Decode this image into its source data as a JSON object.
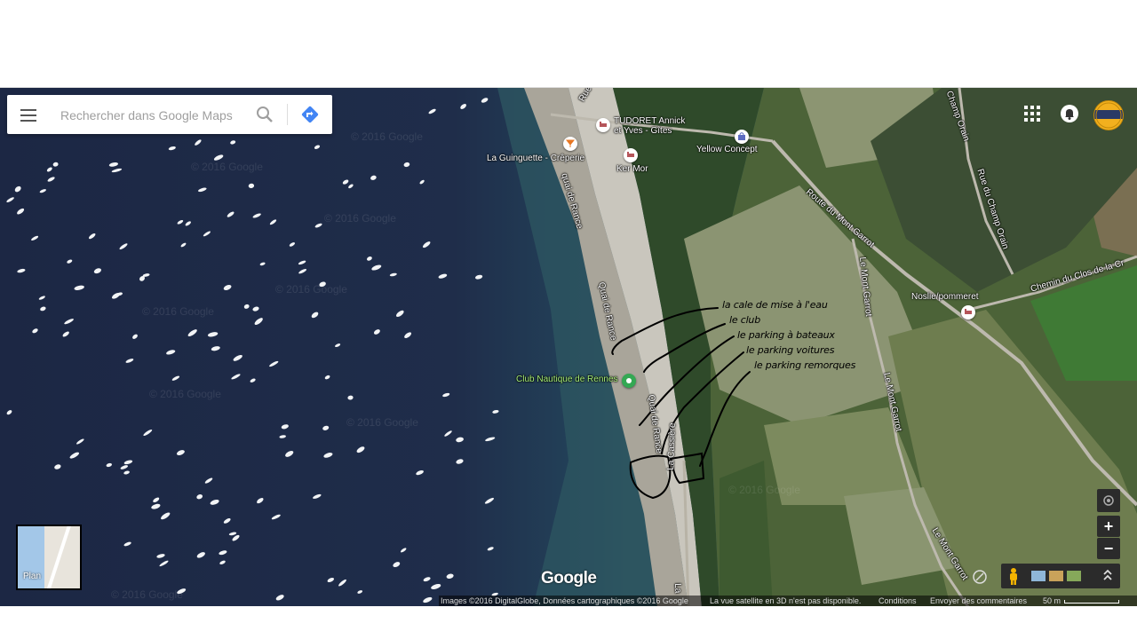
{
  "search": {
    "placeholder": "Rechercher dans Google Maps"
  },
  "icons": {
    "menu": "menu-icon",
    "search": "search-icon",
    "directions": "directions-icon",
    "apps": "apps-grid-icon",
    "notifications": "notifications-icon",
    "avatar": "avatar"
  },
  "pois": [
    {
      "label": "TUDORET Annick et Yves - Gîtes",
      "label_line1": "TUDORET Annick",
      "label_line2": "et Yves - Gîtes",
      "icon": "hotel-icon"
    },
    {
      "label": "La Guinguette - Crêperie",
      "icon": "restaurant-icon"
    },
    {
      "label": "Ker Mor",
      "icon": "hotel-icon"
    },
    {
      "label": "Yellow Concept",
      "icon": "shopping-icon"
    },
    {
      "label": "Noslie/pommeret",
      "icon": "hotel-icon"
    },
    {
      "label": "Club Nautique de Rennes",
      "icon": "sport-icon"
    }
  ],
  "roads": {
    "quai_de_rance_1": "quai de Rance",
    "quai_de_rance_2": "Quai de Rance",
    "quai_de_rance_3": "Quai de Rance",
    "route_mont_garrot": "Route du Mont Garrot",
    "le_mont_garrot_1": "Le Mont Garrot",
    "le_mont_garrot_2": "Le Mont Garrot",
    "le_mont_garrot_3": "Le Mont Garrot",
    "rue_champ_orain": "Rue du Champ Orain",
    "champ_orain_top": "Champ Orain",
    "chemin_clos": "Chemin du Clos de la Cr",
    "la_cassiere": "La Cassière",
    "la_bottom": "La",
    "rue_top": "Rue"
  },
  "annotations": {
    "cale": "la cale de mise à l'eau",
    "club": "le club",
    "parking_bateaux": "le parking à bateaux",
    "parking_voitures": "le parking voitures",
    "parking_remorques": "le parking remorques"
  },
  "plan_thumb": {
    "label": "Plan"
  },
  "controls": {
    "zoom_in": "+",
    "zoom_out": "−",
    "expand": "⌃"
  },
  "logo": "Google",
  "footer": {
    "attribution": "Images ©2016 DigitalGlobe, Données cartographiques ©2016 Google",
    "satellite3d": "La vue satellite en 3D n'est pas disponible.",
    "conditions": "Conditions",
    "feedback": "Envoyer des commentaires",
    "scale": "50 m"
  },
  "watermark": "© 2016 Google",
  "colors": {
    "water": "#1d2a44",
    "shore_water": "#2c4b5a",
    "grass": "#4f6a3a",
    "field": "#7e8b62",
    "annotation": "#000000",
    "avatar": "#f2b01e",
    "directions": "#4285f4"
  }
}
